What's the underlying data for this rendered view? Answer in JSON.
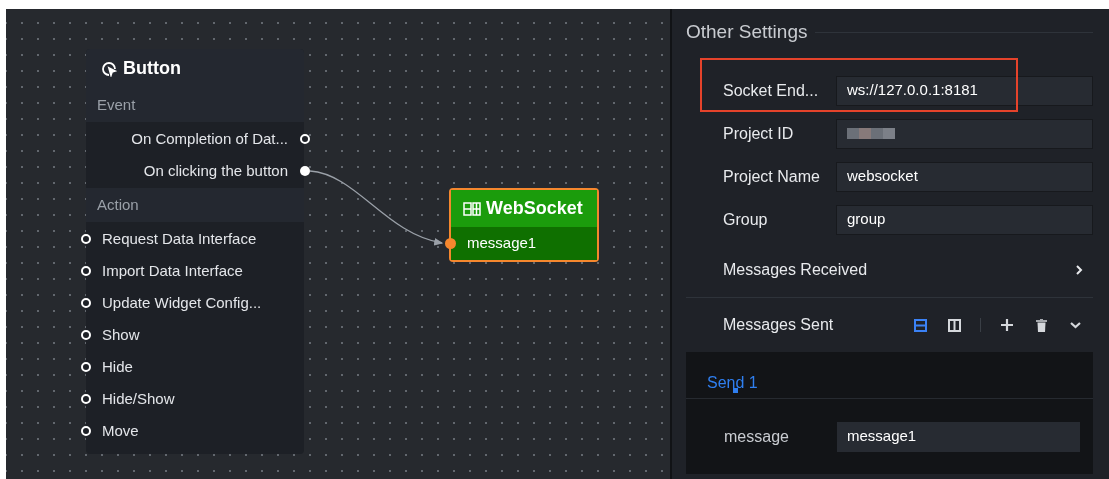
{
  "canvas": {
    "nodes": [
      {
        "kind": "widget",
        "title": "Button",
        "sections": [
          {
            "kind": "event",
            "title": "Event",
            "items": [
              {
                "label": "On Completion of Dat...",
                "connected": false
              },
              {
                "label": "On clicking the button",
                "connected": true
              }
            ]
          },
          {
            "kind": "action",
            "title": "Action",
            "items": [
              {
                "label": "Request Data Interface",
                "connected": false
              },
              {
                "label": "Import Data Interface",
                "connected": false
              },
              {
                "label": "Update Widget Config...",
                "connected": false
              },
              {
                "label": "Show",
                "connected": false
              },
              {
                "label": "Hide",
                "connected": false
              },
              {
                "label": "Hide/Show",
                "connected": false
              },
              {
                "label": "Move",
                "connected": false
              }
            ]
          }
        ]
      },
      {
        "kind": "target",
        "title": "WebSocket",
        "selected": true,
        "inputs": [
          {
            "label": "message1",
            "connected": true
          }
        ]
      }
    ]
  },
  "settings": {
    "title": "Other Settings",
    "fields": [
      {
        "label": "Socket End...",
        "value": "ws://127.0.0.1:8181",
        "highlighted": true,
        "kind": "text"
      },
      {
        "label": "Project ID",
        "kind": "redacted",
        "highlighted": false
      },
      {
        "label": "Project Name",
        "value": "websocket",
        "highlighted": false,
        "kind": "text"
      },
      {
        "label": "Group",
        "value": "group",
        "highlighted": false,
        "kind": "text"
      }
    ],
    "messages_received": {
      "label": "Messages Received",
      "expanded": false
    },
    "messages_sent": {
      "label": "Messages Sent",
      "expanded": true,
      "view_modes": [
        {
          "selected": true
        },
        {
          "selected": false
        }
      ],
      "tabs": [
        {
          "label": "Send 1",
          "selected": true
        }
      ],
      "fields": [
        {
          "label": "message",
          "value": "message1"
        }
      ]
    }
  }
}
